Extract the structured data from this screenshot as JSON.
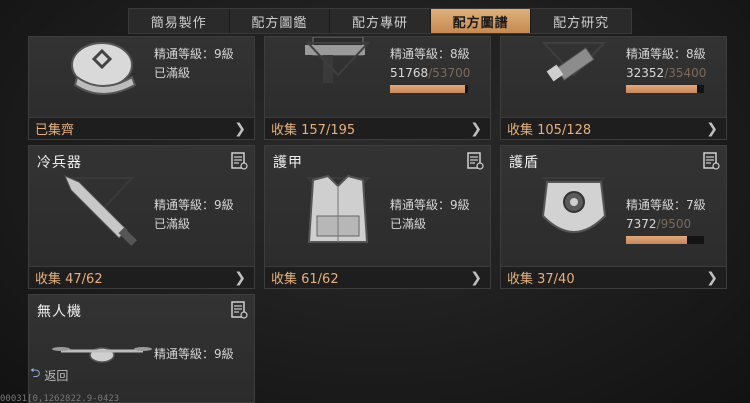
{
  "tabs": [
    {
      "label": "簡易製作",
      "active": false
    },
    {
      "label": "配方圖鑑",
      "active": false
    },
    {
      "label": "配方專研",
      "active": false
    },
    {
      "label": "配方圖譜",
      "active": true
    },
    {
      "label": "配方研究",
      "active": false
    }
  ],
  "cards": {
    "c1": {
      "level": "精通等級：9級",
      "status": "已滿級",
      "footer": "已集齊"
    },
    "c2": {
      "level": "精通等級：8級",
      "progress_value": "51768",
      "progress_max": "/53700",
      "progress_fraction": 0.964,
      "footer": "收集 157/195"
    },
    "c3": {
      "level": "精通等級：8級",
      "progress_value": "32352",
      "progress_max": "/35400",
      "progress_fraction": 0.914,
      "footer": "收集 105/128"
    },
    "c4": {
      "name": "冷兵器",
      "level": "精通等級：9級",
      "status": "已滿級",
      "footer": "收集 47/62"
    },
    "c5": {
      "name": "護甲",
      "level": "精通等級：9級",
      "status": "已滿級",
      "footer": "收集 61/62"
    },
    "c6": {
      "name": "護盾",
      "level": "精通等級：7級",
      "progress_value": "7372",
      "progress_max": "/9500",
      "progress_fraction": 0.776,
      "footer": "收集 37/40"
    },
    "c7": {
      "name": "無人機",
      "level": "精通等級：9級"
    }
  },
  "back_label": "返回",
  "footer_id": "00031[0,1262822.9-0423"
}
